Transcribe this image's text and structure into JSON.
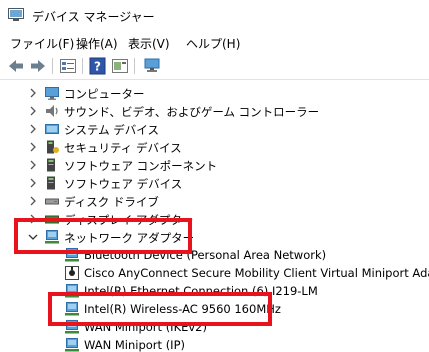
{
  "window": {
    "title": "デバイス マネージャー",
    "app_icon": "device-manager-icon"
  },
  "menu": [
    {
      "id": "file",
      "label": "ファイル(F)"
    },
    {
      "id": "action",
      "label": "操作(A)"
    },
    {
      "id": "view",
      "label": "表示(V)"
    },
    {
      "id": "help",
      "label": "ヘルプ(H)"
    }
  ],
  "toolbar": [
    {
      "id": "back",
      "icon": "back-arrow-icon"
    },
    {
      "id": "forward",
      "icon": "forward-arrow-icon"
    },
    {
      "id": "properties",
      "icon": "properties-icon"
    },
    {
      "id": "help",
      "icon": "help-icon"
    },
    {
      "id": "view-device",
      "icon": "device-view-icon"
    },
    {
      "id": "scan",
      "icon": "scan-hardware-icon"
    }
  ],
  "tree": {
    "categories_before": [
      {
        "label": "コンピューター",
        "icon": "computer-icon"
      },
      {
        "label": "サウンド、ビデオ、およびゲーム コントローラー",
        "icon": "speaker-icon"
      },
      {
        "label": "システム デバイス",
        "icon": "system-device-icon"
      },
      {
        "label": "セキュリティ デバイス",
        "icon": "security-device-icon"
      },
      {
        "label": "ソフトウェア コンポーネント",
        "icon": "software-component-icon"
      },
      {
        "label": "ソフトウェア デバイス",
        "icon": "software-device-icon"
      },
      {
        "label": "ディスク ドライブ",
        "icon": "disk-drive-icon"
      },
      {
        "label": "ディスプレイ アダプター",
        "icon": "display-adapter-icon"
      }
    ],
    "expanded_category": {
      "label": "ネットワーク アダプター",
      "icon": "network-adapter-icon",
      "expanded": true
    },
    "network_adapters": [
      {
        "label": "Bluetooth Device (Personal Area Network)",
        "icon": "network-adapter-icon"
      },
      {
        "label": "Cisco AnyConnect Secure Mobility Client Virtual Miniport Adapte",
        "icon": "cisco-adapter-icon"
      },
      {
        "label": "Intel(R) Ethernet Connection (6) I219-LM",
        "icon": "network-adapter-icon"
      },
      {
        "label": "Intel(R) Wireless-AC 9560 160MHz",
        "icon": "network-adapter-icon"
      },
      {
        "label": "WAN Miniport (IKEv2)",
        "icon": "network-adapter-icon"
      },
      {
        "label": "WAN Miniport (IP)",
        "icon": "network-adapter-icon"
      }
    ]
  },
  "highlight_color": "#e8131c"
}
